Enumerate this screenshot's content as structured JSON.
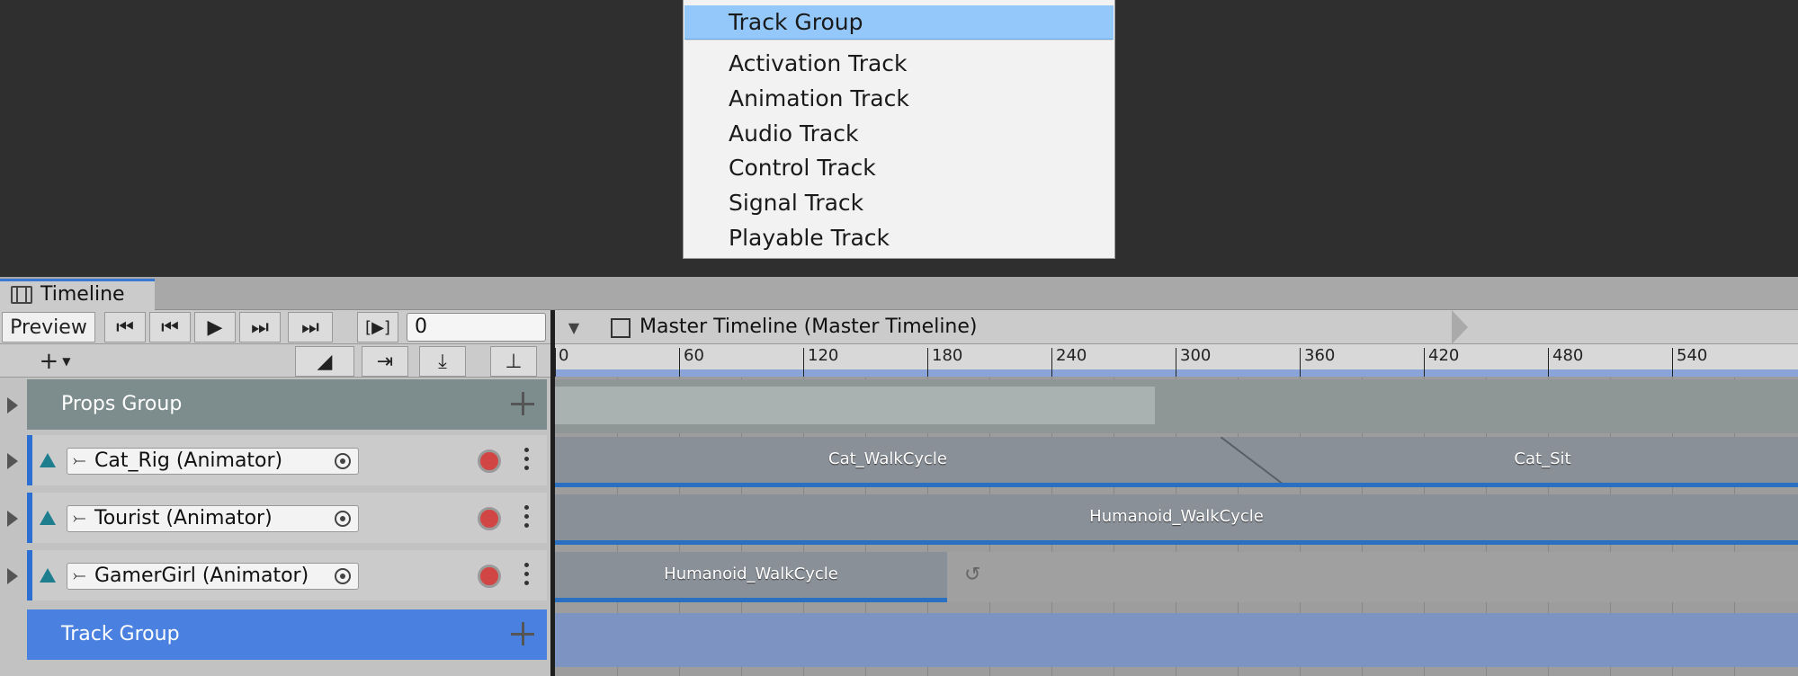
{
  "menu": {
    "items": [
      "Track Group",
      "Activation Track",
      "Animation Track",
      "Audio Track",
      "Control Track",
      "Signal Track",
      "Playable Track"
    ],
    "selected": "Track Group"
  },
  "window": {
    "tab_label": "Timeline"
  },
  "toolbar": {
    "preview_label": "Preview",
    "frame_value": "0",
    "frame_bracket_label": "[▶]"
  },
  "breadcrumb": {
    "label": "Master Timeline (Master Timeline)"
  },
  "ruler": {
    "ticks": [
      "0",
      "60",
      "120",
      "180",
      "240",
      "300",
      "360",
      "420",
      "480",
      "540"
    ]
  },
  "tracks": [
    {
      "type": "group",
      "name": "Props Group",
      "color": "#7d8c8c"
    },
    {
      "type": "animation",
      "name": "Cat_Rig (Animator)",
      "clips": [
        "Cat_WalkCycle",
        "Cat_Sit"
      ]
    },
    {
      "type": "animation",
      "name": "Tourist (Animator)",
      "clips": [
        "Humanoid_WalkCycle"
      ]
    },
    {
      "type": "animation",
      "name": "GamerGirl (Animator)",
      "clips": [
        "Humanoid_WalkCycle"
      ]
    },
    {
      "type": "group",
      "name": "Track Group",
      "color": "#4a80df"
    }
  ],
  "colors": {
    "accent": "#2c6ed2",
    "menu_highlight": "#94c7fa",
    "record": "#d24545"
  },
  "icons": [
    "timeline-icon",
    "skip-start-icon",
    "prev-frame-icon",
    "play-icon",
    "next-frame-icon",
    "skip-end-icon",
    "cube-icon",
    "add-icon",
    "record-icon",
    "more-icon",
    "object-picker-icon",
    "animator-icon",
    "loop-icon"
  ]
}
